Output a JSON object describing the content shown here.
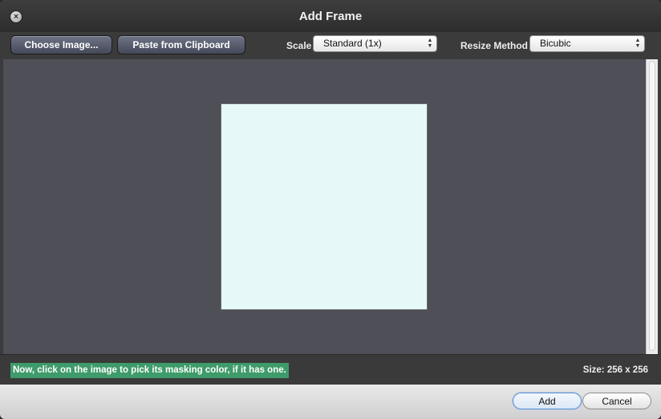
{
  "window": {
    "title": "Add Frame"
  },
  "toolbar": {
    "choose_image_label": "Choose Image...",
    "paste_label": "Paste from Clipboard",
    "scale_label": "Scale",
    "scale_value": "Standard (1x)",
    "resize_label": "Resize Method",
    "resize_value": "Bicubic"
  },
  "canvas": {
    "image_color": "#e6f9f8",
    "background_color": "#4e4f57"
  },
  "status": {
    "hint": "Now, click on the image to pick its masking color, if it has one.",
    "hint_color": "#3e9b6a",
    "size_text": "Size: 256 x 256"
  },
  "footer": {
    "add_label": "Add",
    "cancel_label": "Cancel"
  },
  "icons": {
    "close": "close-icon",
    "select_arrows": "updown-arrows-icon"
  }
}
